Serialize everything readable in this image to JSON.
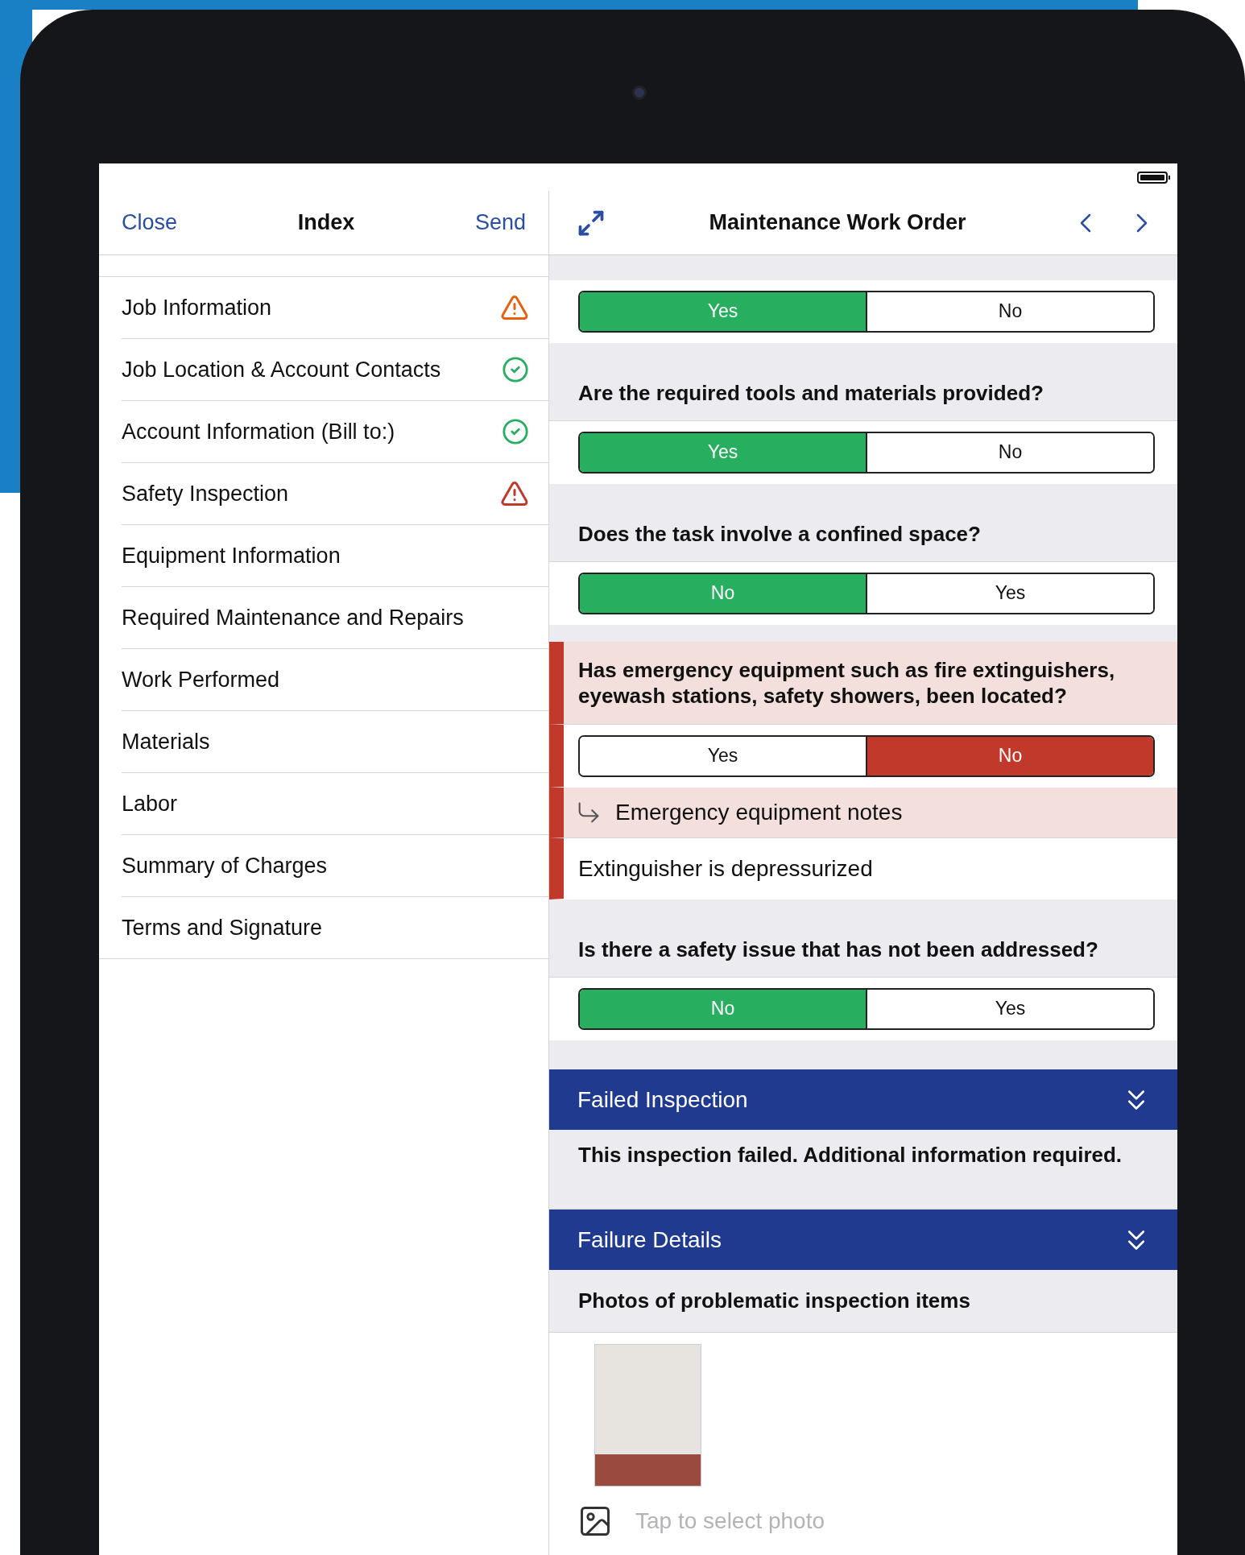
{
  "index": {
    "close": "Close",
    "title": "Index",
    "send": "Send",
    "items": [
      {
        "label": "Job Information",
        "kind": "warning"
      },
      {
        "label": "Job Location & Account Contacts",
        "kind": "complete"
      },
      {
        "label": "Account Information (Bill to:)",
        "kind": "complete"
      },
      {
        "label": "Safety Inspection",
        "kind": "error"
      },
      {
        "label": "Equipment Information",
        "kind": "plain"
      },
      {
        "label": "Required Maintenance and Repairs",
        "kind": "plain"
      },
      {
        "label": "Work Performed",
        "kind": "plain"
      },
      {
        "label": "Materials",
        "kind": "plain"
      },
      {
        "label": "Labor",
        "kind": "plain"
      },
      {
        "label": "Summary of Charges",
        "kind": "plain"
      },
      {
        "label": "Terms and Signature",
        "kind": "plain"
      }
    ]
  },
  "form": {
    "title": "Maintenance Work Order",
    "items": [
      {
        "kind": "choice",
        "flagged": false,
        "options": [
          {
            "label": "Yes",
            "selected": true
          },
          {
            "label": "No",
            "selected": false
          }
        ]
      },
      {
        "kind": "question",
        "flagged": false,
        "text": "Are the required tools and materials provided?"
      },
      {
        "kind": "choice",
        "flagged": false,
        "options": [
          {
            "label": "Yes",
            "selected": true
          },
          {
            "label": "No",
            "selected": false
          }
        ]
      },
      {
        "kind": "question",
        "flagged": false,
        "text": "Does the task involve a confined space?"
      },
      {
        "kind": "choice",
        "flagged": false,
        "options": [
          {
            "label": "No",
            "selected": true
          },
          {
            "label": "Yes",
            "selected": false
          }
        ]
      },
      {
        "kind": "question",
        "flagged": true,
        "text": "Has emergency equipment such as fire extinguishers, eyewash stations, safety showers, been located?"
      },
      {
        "kind": "choice",
        "flagged": true,
        "options": [
          {
            "label": "Yes",
            "selected": false
          },
          {
            "label": "No",
            "selected": true
          }
        ]
      },
      {
        "kind": "note_label",
        "flagged": true,
        "text": "Emergency equipment notes"
      },
      {
        "kind": "note_value",
        "flagged": true,
        "text": "Extinguisher is depressurized"
      },
      {
        "kind": "question",
        "flagged": false,
        "text": "Is there a safety issue that has not been addressed?"
      },
      {
        "kind": "choice",
        "flagged": false,
        "options": [
          {
            "label": "No",
            "selected": true
          },
          {
            "label": "Yes",
            "selected": false
          }
        ]
      },
      {
        "kind": "section_header",
        "text": "Failed Inspection"
      },
      {
        "kind": "message",
        "text": "This inspection failed. Additional information required."
      },
      {
        "kind": "section_header",
        "text": "Failure Details"
      },
      {
        "kind": "photo_label",
        "text": "Photos of problematic inspection items"
      },
      {
        "kind": "photos"
      },
      {
        "kind": "photo_picker",
        "placeholder": "Tap to select photo"
      }
    ]
  }
}
